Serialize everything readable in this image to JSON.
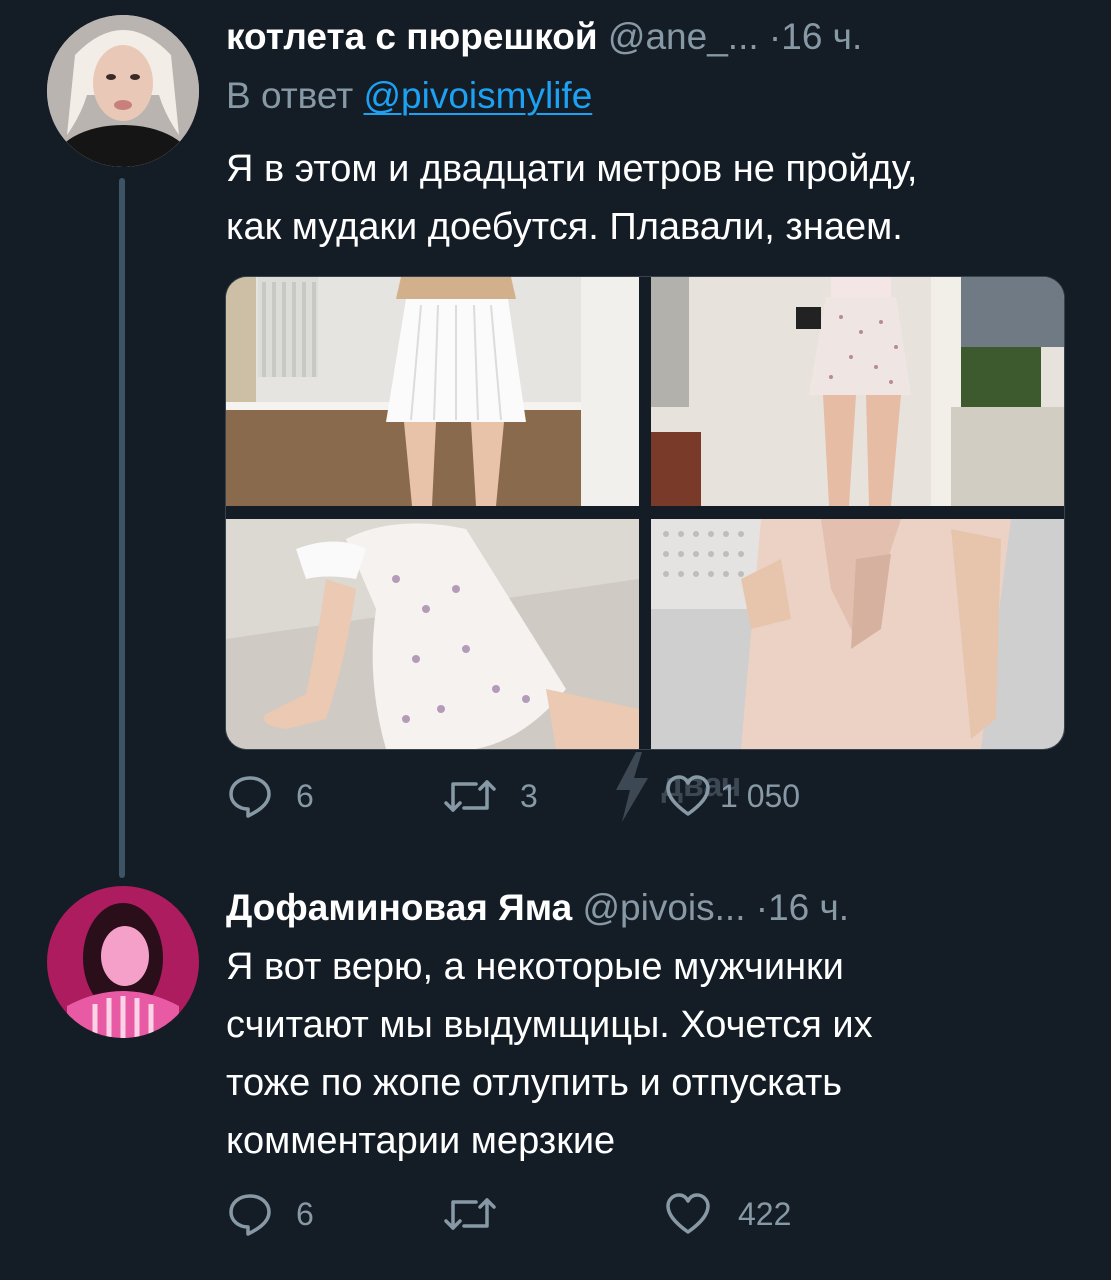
{
  "tweet1": {
    "display_name": "котлета с пюрешкой",
    "handle": "@ane_...",
    "dot": "·",
    "time": "16 ч.",
    "reply_prefix": "В ответ",
    "reply_mention": "@pivoismylife",
    "text_lines": [
      "Я в этом и двадцати метров не пройду,",
      "как мудаки доебутся. Плавали, знаем."
    ],
    "media_count": 4,
    "actions": {
      "replies": "6",
      "retweets": "3",
      "likes": "1 050"
    }
  },
  "tweet2": {
    "display_name": "Дофаминовая Яма",
    "handle": "@pivois...",
    "dot": "·",
    "time": "16 ч.",
    "text_lines": [
      "Я вот верю, а некоторые мужчинки",
      "считают мы выдумщицы. Хочется их",
      "тоже по жопе отлупить и отпускать",
      "комментарии мерзкие"
    ],
    "actions": {
      "replies": "6",
      "retweets": "",
      "likes": "422"
    }
  },
  "icons": {
    "reply": "reply-icon",
    "retweet": "retweet-icon",
    "like": "heart-icon"
  },
  "colors": {
    "background": "#141d26",
    "secondary_text": "#8899a6",
    "link": "#1da1f2",
    "thread_line": "#3d5466"
  },
  "watermark": "двач"
}
